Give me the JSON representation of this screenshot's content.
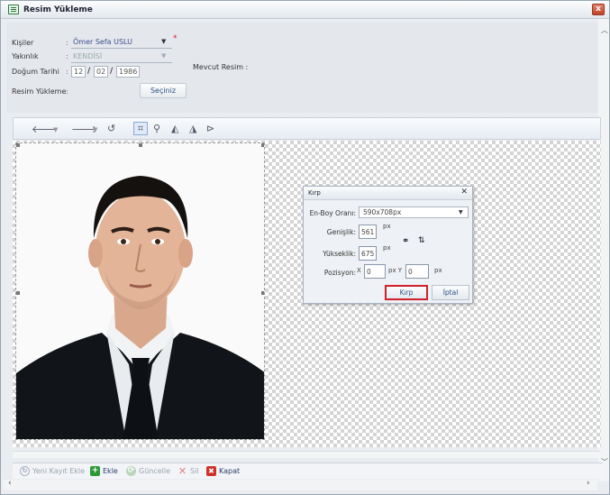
{
  "window": {
    "title": "Resim Yükleme",
    "close_glyph": "x"
  },
  "form": {
    "kisiler": {
      "label": "Kişiler",
      "value": "Ömer Sefa USLU",
      "required": "*"
    },
    "yakinlik": {
      "label": "Yakınlık",
      "value": "KENDİSİ"
    },
    "dogum_tarihi": {
      "label": "Doğum Tarihi",
      "day": "12",
      "month": "02",
      "year": "1986"
    },
    "resim_yukleme": {
      "label": "Resim Yükleme",
      "button": "Seçiniz"
    },
    "mevcut_resim": {
      "label": "Mevcut Resim :"
    },
    "colon": ":"
  },
  "toolbar": {
    "icons": [
      "undo-icon",
      "redo-icon",
      "rotate-icon",
      "crop-icon",
      "zoom-icon",
      "brightness-icon",
      "contrast-icon",
      "flip-icon"
    ],
    "undo": "🡐",
    "redo": "🡒",
    "rotate": "↺",
    "crop": "⌗",
    "zoom": "⚲",
    "brightness": "◭",
    "contrast": "◮",
    "flip": "⊳"
  },
  "crop_dialog": {
    "title": "Kırp",
    "close": "✕",
    "aspect_label": "En-Boy Oranı:",
    "aspect_value": "590x708px",
    "width_label": "Genişlik:",
    "width_value": "561",
    "height_label": "Yükseklik:",
    "height_value": "675",
    "unit": "px",
    "position_label": "Pozisyon:",
    "x_label": "X",
    "x_value": "0",
    "y_label": "px Y",
    "y_value": "0",
    "crop_button": "Kırp",
    "cancel_button": "İptal"
  },
  "footer": {
    "new_record": "Yeni Kayıt Ekle",
    "add": "Ekle",
    "update": "Güncelle",
    "delete": "Sil",
    "close": "Kapat"
  },
  "colors": {
    "accent": "#2d4f86",
    "close_red": "#c0422a",
    "crop_highlight": "#d0202a",
    "add_green": "#2d9a3a"
  }
}
